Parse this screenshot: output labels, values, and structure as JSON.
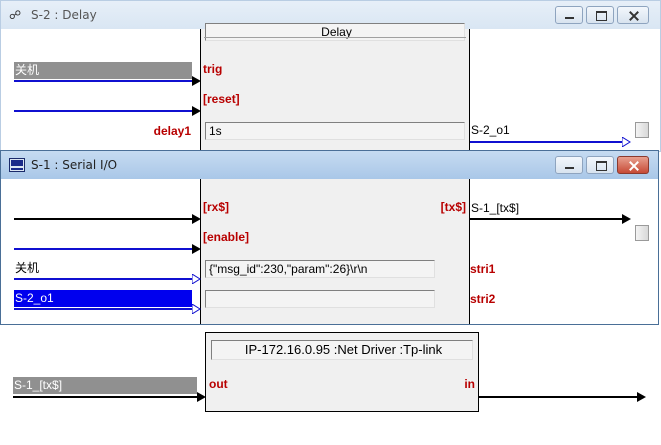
{
  "delay_window": {
    "title": "S-2 : Delay",
    "icon": "network-icon",
    "symbol_name": "Delay",
    "inputs": [
      {
        "signal": "关机",
        "port": "trig"
      },
      {
        "signal": "",
        "port": "[reset]"
      }
    ],
    "param_label": "delay1",
    "param_value": "1s",
    "output_signal": "S-2_o1"
  },
  "serial_window": {
    "title": "S-1 : Serial I/O",
    "icon": "serial-icon",
    "inputs": [
      {
        "signal": "",
        "port": "[rx$]"
      },
      {
        "signal": "",
        "port": "[enable]"
      }
    ],
    "output_port": "[tx$]",
    "output_signal": "S-1_[tx$]",
    "params": [
      {
        "signal": "关机",
        "value": "{\"msg_id\":230,\"param\":26}\\r\\n",
        "port": "stri1"
      },
      {
        "signal": "S-2_o1",
        "value": "",
        "port": "stri2"
      }
    ]
  },
  "net_driver": {
    "title": "IP-172.16.0.95 :Net Driver :Tp-link",
    "input_signal": "S-1_[tx$]",
    "input_port": "out",
    "output_port": "in"
  }
}
